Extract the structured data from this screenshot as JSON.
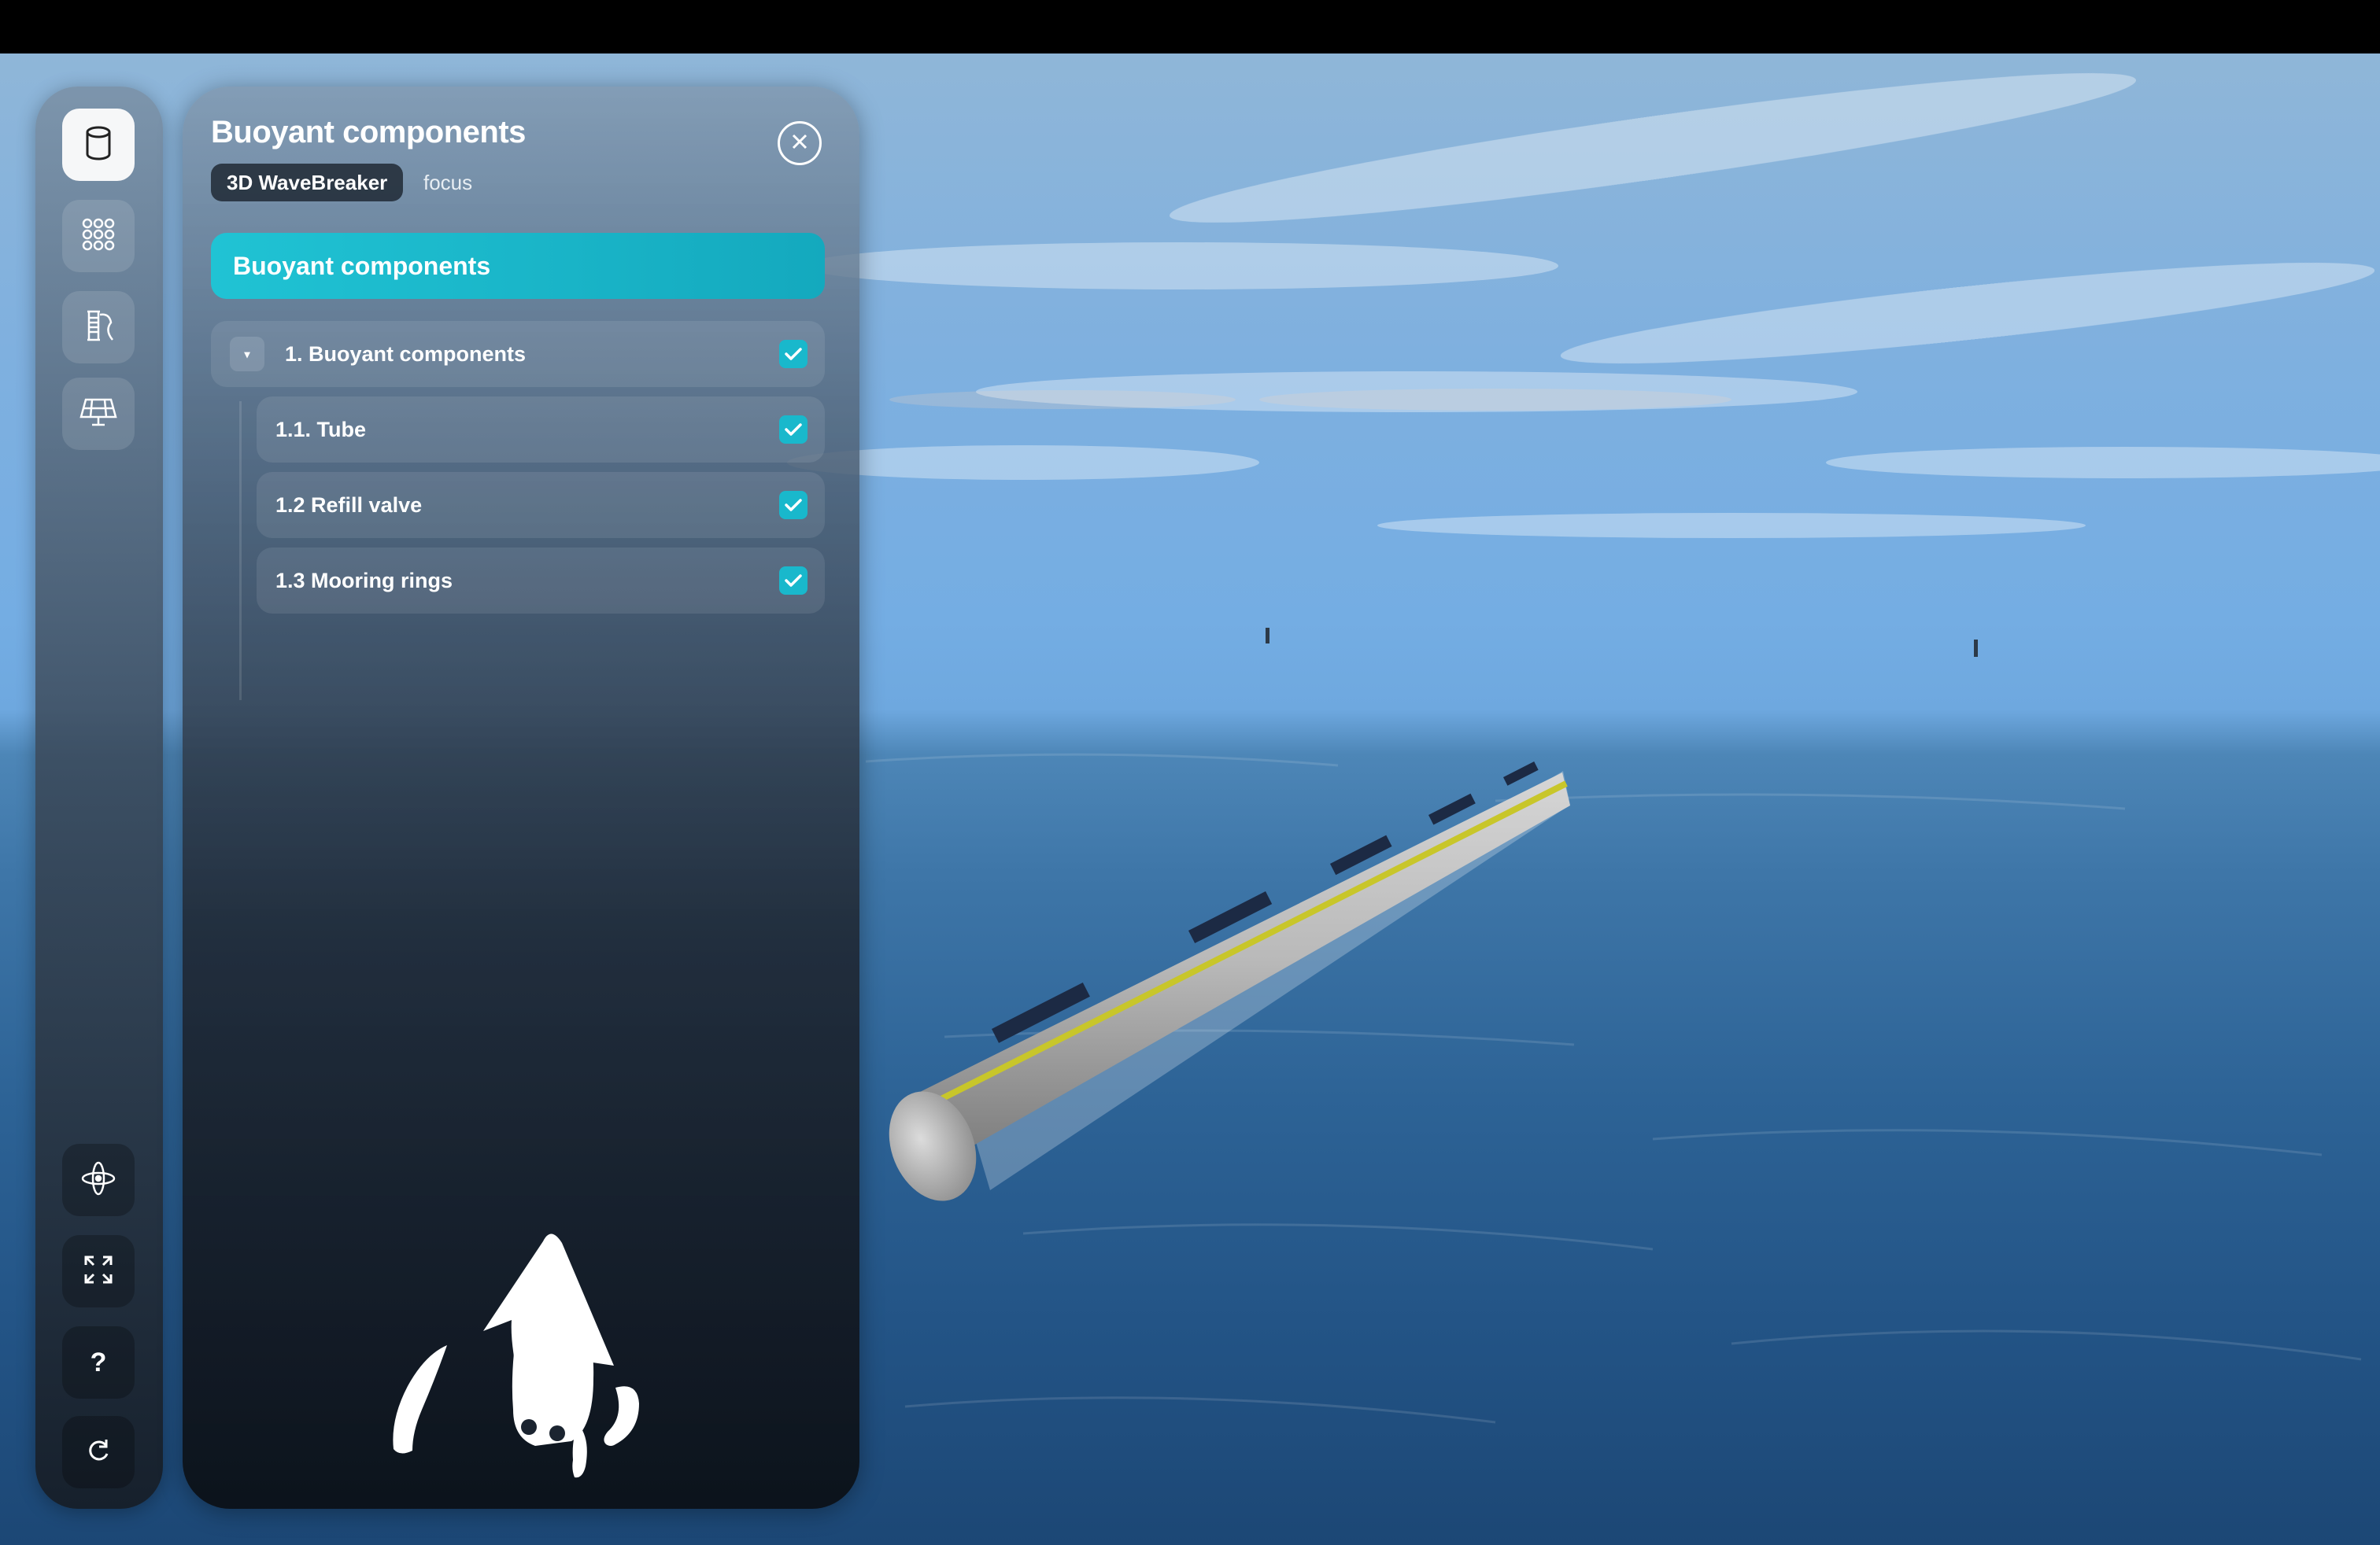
{
  "panel": {
    "title": "Buoyant components",
    "chip": "3D WaveBreaker",
    "mode": "focus",
    "banner": "Buoyant components",
    "tree": [
      {
        "label": "1. Buoyant components",
        "checked": true
      },
      {
        "label": "1.1. Tube",
        "checked": true
      },
      {
        "label": "1.2 Refill valve",
        "checked": true
      },
      {
        "label": "1.3 Mooring rings",
        "checked": true
      }
    ]
  },
  "rail": {
    "top": [
      "cylinder-icon",
      "grid-dots-icon",
      "cable-spool-icon",
      "solar-panel-icon"
    ],
    "bottom": [
      "rotate-3d-icon",
      "expand-icon",
      "help-icon",
      "reload-icon"
    ],
    "help_label": "?"
  },
  "colors": {
    "accent": "#14a9be",
    "check": "#19b8cc"
  }
}
